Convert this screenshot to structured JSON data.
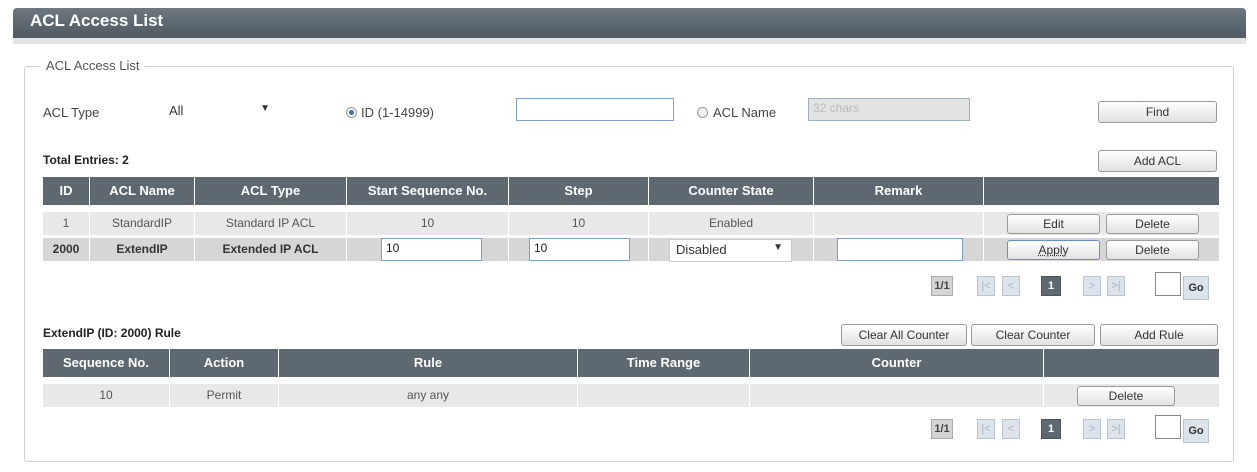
{
  "page": {
    "title": "ACL Access List",
    "section_legend": "ACL Access List"
  },
  "filter": {
    "acl_type_label": "ACL Type",
    "acl_type_value": "All",
    "id_radio_label": "ID (1-14999)",
    "id_value": "",
    "name_radio_label": "ACL Name",
    "name_placeholder": "32 chars",
    "find_label": "Find"
  },
  "acl": {
    "total_entries": "Total Entries: 2",
    "add_label": "Add ACL",
    "columns": [
      "ID",
      "ACL Name",
      "ACL Type",
      "Start Sequence No.",
      "Step",
      "Counter State",
      "Remark"
    ],
    "rows": [
      {
        "id": "1",
        "name": "StandardIP",
        "type": "Standard IP ACL",
        "start_seq": "10",
        "step": "10",
        "counter_state": "Enabled",
        "remark": "",
        "btn1": "Edit",
        "btn2": "Delete"
      },
      {
        "id": "2000",
        "name": "ExtendIP",
        "type": "Extended IP ACL",
        "start_seq": "10",
        "step": "10",
        "counter_state": "Disabled",
        "remark": "",
        "btn1": "Apply",
        "btn2": "Delete"
      }
    ],
    "pager": {
      "page_info": "1/1",
      "first": "|<",
      "prev": "<",
      "current": "1",
      "next": ">",
      "last": ">|",
      "go": "Go"
    }
  },
  "rules": {
    "title": "ExtendIP (ID: 2000) Rule",
    "clear_all_label": "Clear All Counter",
    "clear_label": "Clear Counter",
    "add_label": "Add Rule",
    "columns": [
      "Sequence No.",
      "Action",
      "Rule",
      "Time Range",
      "Counter"
    ],
    "rows": [
      {
        "seq": "10",
        "action": "Permit",
        "rule": "any any",
        "time_range": "",
        "counter": "",
        "btn": "Delete"
      }
    ],
    "pager": {
      "page_info": "1/1",
      "first": "|<",
      "prev": "<",
      "current": "1",
      "next": ">",
      "last": ">|",
      "go": "Go"
    }
  },
  "colors": {
    "header_bg": "#5d6870",
    "row_odd": "#e8e8e8",
    "row_even": "#d6d6d6",
    "accent": "#3a6fb5"
  }
}
